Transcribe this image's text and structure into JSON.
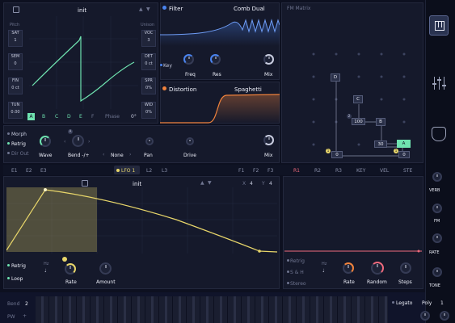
{
  "osc": {
    "preset": "init",
    "left_labels": [
      "Pitch",
      "SAT",
      "SEM",
      "FIN",
      "TUN"
    ],
    "left_values": [
      "1",
      "0",
      "0 ct",
      "0.00"
    ],
    "right_labels": [
      "Unison",
      "VOC",
      "DET",
      "SPR",
      "WID"
    ],
    "right_values": [
      "3",
      "0 ct",
      "0%",
      "0%"
    ],
    "wave_letters": [
      "A",
      "B",
      "C",
      "D",
      "E",
      "F"
    ],
    "phase_label": "Phase",
    "phase_value": "0°"
  },
  "filter": {
    "label": "Filter",
    "type": "Comb Dual",
    "key_label": "Key",
    "freq_label": "Freq",
    "res_label": "Res",
    "mix_label": "Mix"
  },
  "distortion": {
    "label": "Distortion",
    "type": "Spaghetti",
    "drive_label": "Drive",
    "mix_label": "Mix"
  },
  "osc_bottom": {
    "morph": "Morph",
    "retrig": "Retrig",
    "dir_out": "Dir Out",
    "wave": "Wave",
    "bend": "Bend -/+",
    "none": "None",
    "pan": "Pan"
  },
  "fm_matrix": {
    "title": "FM Matrix",
    "nodes": [
      "D",
      "C",
      "100",
      "B",
      "30",
      "A"
    ],
    "badges": [
      "2",
      "1",
      "1"
    ],
    "zeros": [
      "0",
      "0"
    ]
  },
  "mod_tabs_left": [
    "E1",
    "E2",
    "E3"
  ],
  "lfo_tabs": [
    "LFO 1",
    "L2",
    "L3"
  ],
  "mod_tabs_mid": [
    "F1",
    "F2",
    "F3"
  ],
  "lfo": {
    "preset": "init",
    "x_label": "X",
    "x_value": "4",
    "y_label": "Y",
    "y_value": "4",
    "retrig": "Retrig",
    "loop": "Loop",
    "hz": "Hz",
    "rate": "Rate",
    "amount": "Amount"
  },
  "rand_tabs": [
    "R1",
    "R2",
    "R3",
    "KEY",
    "VEL",
    "STE"
  ],
  "rand": {
    "retrig": "Retrig",
    "sh": "S & H",
    "stereo": "Stereo",
    "hz": "Hz",
    "rate": "Rate",
    "random": "Random",
    "steps": "Steps"
  },
  "sidebar": {
    "verb": "VERB",
    "fm": "FM",
    "rate": "RATE",
    "tone": "TONE"
  },
  "bottom": {
    "bend_label": "Bend",
    "bend_value": "2",
    "pw_label": "PW",
    "legato": "Legato",
    "poly_label": "Poly",
    "poly_value": "1"
  },
  "colors": {
    "accent_green": "#6fe3b0",
    "accent_yellow": "#e8d66a",
    "accent_orange": "#f0823c",
    "accent_blue": "#4a84f0",
    "accent_pink": "#f06a7c"
  }
}
